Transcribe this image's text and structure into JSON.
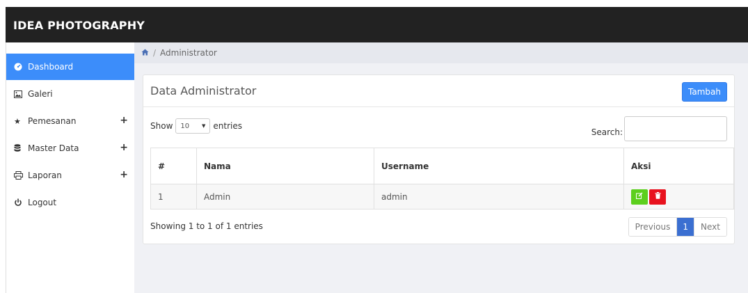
{
  "app": {
    "brand": "IDEA PHOTOGRAPHY"
  },
  "sidebar": {
    "items": [
      {
        "label": "Dashboard",
        "icon": "dashboard-icon",
        "active": true
      },
      {
        "label": "Galeri",
        "icon": "image-icon"
      },
      {
        "label": "Pemesanan",
        "icon": "star-icon",
        "expand": "+"
      },
      {
        "label": "Master Data",
        "icon": "database-icon",
        "expand": "+"
      },
      {
        "label": "Laporan",
        "icon": "print-icon",
        "expand": "+"
      },
      {
        "label": "Logout",
        "icon": "power-icon"
      }
    ]
  },
  "breadcrumb": {
    "separator": "/",
    "current": "Administrator"
  },
  "panel": {
    "title": "Data Administrator",
    "add_label": "Tambah",
    "length": {
      "show": "Show",
      "value": "10",
      "entries": "entries"
    },
    "search_label": "Search:",
    "search_value": ""
  },
  "table": {
    "headers": [
      "#",
      "Nama",
      "Username",
      "Aksi"
    ],
    "rows": [
      {
        "no": "1",
        "nama": "Admin",
        "username": "admin"
      }
    ]
  },
  "footer": {
    "info": "Showing 1 to 1 of 1 entries",
    "previous": "Previous",
    "page": "1",
    "next": "Next"
  },
  "colors": {
    "accent": "#3c8dfa",
    "topbar": "#222222",
    "edit": "#5ccf1d",
    "delete": "#e8121e",
    "page_active": "#3b6fd1"
  }
}
